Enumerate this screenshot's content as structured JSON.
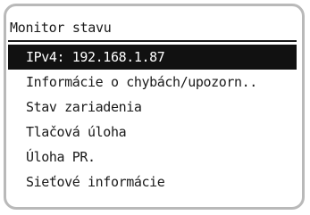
{
  "panel": {
    "title": "Monitor stavu",
    "items": [
      {
        "label": "IPv4: 192.168.1.87",
        "selected": true
      },
      {
        "label": "Informácie o chybách/upozorn..",
        "selected": false
      },
      {
        "label": "Stav zariadenia",
        "selected": false
      },
      {
        "label": "Tlačová úloha",
        "selected": false
      },
      {
        "label": "Úloha PR.",
        "selected": false
      },
      {
        "label": "Sieťové informácie",
        "selected": false
      }
    ]
  },
  "colors": {
    "background": "#ffffff",
    "frame_border": "#b9b9b9",
    "text": "#1a1a1a",
    "highlight_background": "#111111",
    "highlight_text": "#ffffff"
  }
}
